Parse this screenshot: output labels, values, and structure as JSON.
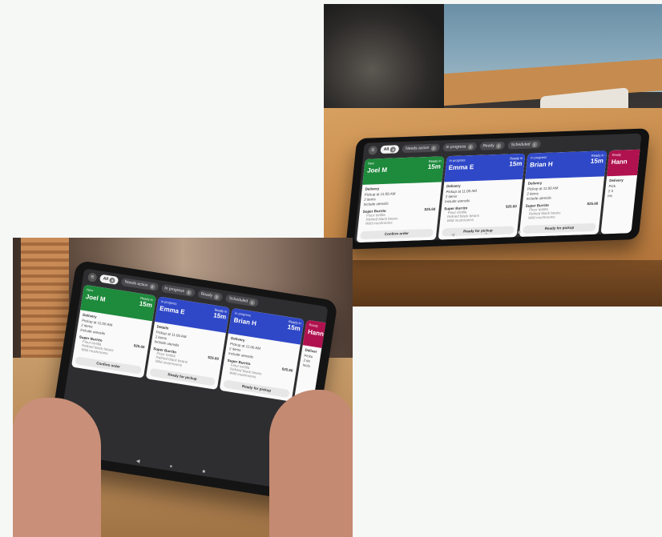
{
  "photos": [
    {
      "id": "counter-photo",
      "topbar": {
        "all_label": "All",
        "all_count": "8",
        "filters": [
          {
            "label": "Needs action",
            "count": "2"
          },
          {
            "label": "In progress",
            "count": "3"
          },
          {
            "label": "Ready",
            "count": "2"
          },
          {
            "label": "Scheduled",
            "count": "1"
          }
        ]
      },
      "cards": [
        {
          "status": "New",
          "name": "Joel M",
          "ready_label": "Ready in",
          "eta": "15m",
          "color": "#1e8a3c",
          "section": "Delivery",
          "details": [
            "Pickup at 11:00 AM",
            "2 items",
            "Include utensils"
          ],
          "item": "Super Burrito",
          "price": "$25.60",
          "subs": [
            "Flour tortilla",
            "Refried black beans",
            "Wild mushrooms"
          ],
          "button": "Confirm order"
        },
        {
          "status": "In progress",
          "name": "Emma E",
          "ready_label": "Ready in",
          "eta": "15m",
          "color": "#2f48c8",
          "section": "Delivery",
          "details": [
            "Pickup at 11:00 AM",
            "2 items",
            "Include utensils"
          ],
          "item": "Super Burrito",
          "price": "$25.60",
          "subs": [
            "Flour tortilla",
            "Refried black beans",
            "Wild mushrooms"
          ],
          "button": "Ready for pickup"
        },
        {
          "status": "In progress",
          "name": "Brian H",
          "ready_label": "Ready in",
          "eta": "15m",
          "color": "#2f48c8",
          "section": "Delivery",
          "details": [
            "Pickup at 11:00 AM",
            "2 items",
            "Include utensils"
          ],
          "item": "Super Burrito",
          "price": "$25.60",
          "subs": [
            "Flour tortilla",
            "Refried black beans",
            "Wild mushrooms"
          ],
          "button": "Ready for pickup"
        },
        {
          "status": "Ready",
          "name": "Hann",
          "ready_label": "",
          "eta": "",
          "color": "#b0124f",
          "section": "Delivery",
          "details": [
            "Pick",
            "2 it",
            "Inc"
          ],
          "item": "",
          "price": "",
          "subs": [],
          "button": ""
        }
      ]
    },
    {
      "id": "handheld-photo",
      "topbar": {
        "all_label": "All",
        "all_count": "8",
        "filters": [
          {
            "label": "Needs action",
            "count": "2"
          },
          {
            "label": "In progress",
            "count": "3"
          },
          {
            "label": "Ready",
            "count": "2"
          },
          {
            "label": "Scheduled",
            "count": "1"
          }
        ]
      },
      "cards": [
        {
          "status": "New",
          "name": "Joel M",
          "ready_label": "Ready in",
          "eta": "15m",
          "color": "#1e8a3c",
          "section": "Delivery",
          "details": [
            "Pickup at 11:00 AM",
            "2 items",
            "Include utensils"
          ],
          "item": "Super Burrito",
          "price": "$25.60",
          "subs": [
            "Flour tortilla",
            "Refried black beans",
            "Wild mushrooms"
          ],
          "button": "Confirm order"
        },
        {
          "status": "In progress",
          "name": "Emma E",
          "ready_label": "Ready in",
          "eta": "15m",
          "color": "#2f48c8",
          "section": "Details",
          "details": [
            "Pickup at 11:00 AM",
            "2 items",
            "Include utensils"
          ],
          "item": "Super Burrito",
          "price": "$25.60",
          "subs": [
            "Flour tortilla",
            "Refried black beans",
            "Wild mushrooms"
          ],
          "button": "Ready for pickup"
        },
        {
          "status": "In progress",
          "name": "Brian H",
          "ready_label": "Ready in",
          "eta": "15m",
          "color": "#2f48c8",
          "section": "Delivery",
          "details": [
            "Pickup at 11:00 AM",
            "2 items",
            "Include utensils"
          ],
          "item": "Super Burrito",
          "price": "$25.60",
          "subs": [
            "Flour tortilla",
            "Refried black beans",
            "Wild mushrooms"
          ],
          "button": "Ready for pickup"
        },
        {
          "status": "Ready",
          "name": "Hann",
          "ready_label": "",
          "eta": "",
          "color": "#b0124f",
          "section": "Deliver",
          "details": [
            "Picku",
            "2 ite",
            "Inclu"
          ],
          "item": "",
          "price": "",
          "subs": [],
          "button": ""
        }
      ]
    }
  ],
  "nav_glyphs": "◀ ● ■"
}
